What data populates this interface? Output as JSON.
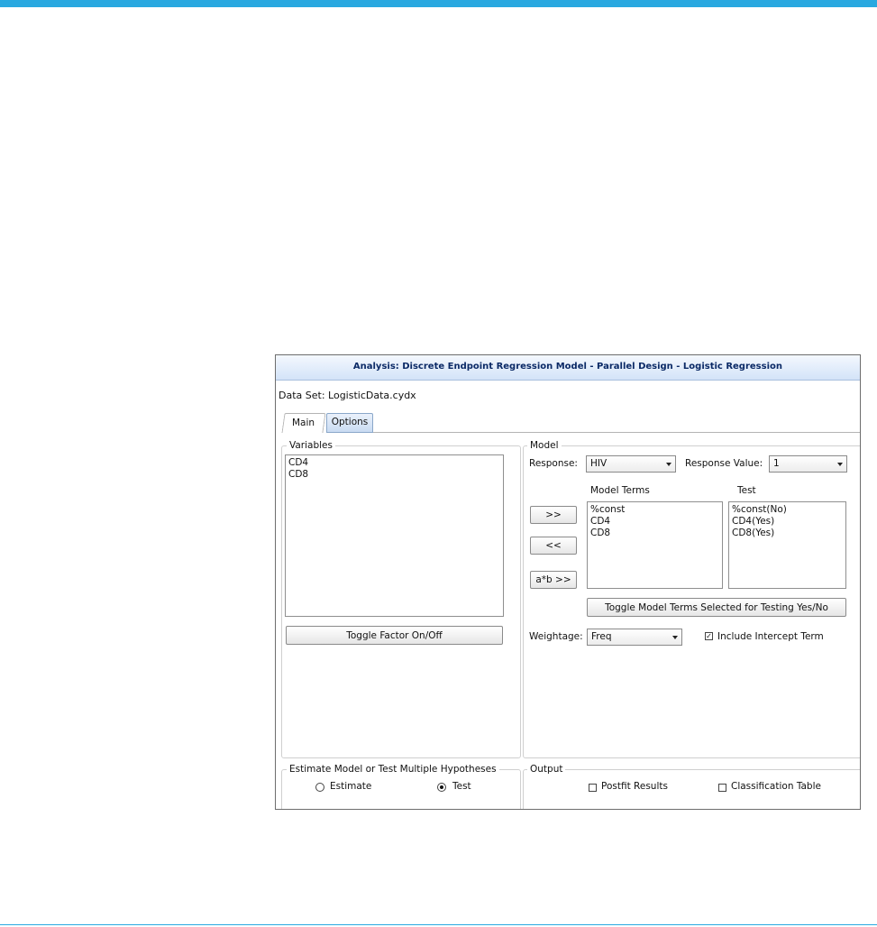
{
  "dialog": {
    "title": "Analysis: Discrete Endpoint Regression Model - Parallel Design - Logistic Regression",
    "dataset_label": "Data Set: LogisticData.cydx",
    "tabs": [
      {
        "label": "Main",
        "selected": true
      },
      {
        "label": "Options",
        "selected": false
      }
    ]
  },
  "variables": {
    "legend": "Variables",
    "items": [
      "CD4",
      "CD8"
    ],
    "toggle_button": "Toggle Factor On/Off"
  },
  "model": {
    "legend": "Model",
    "response_label": "Response:",
    "response_value": "HIV",
    "response_value_label": "Response Value:",
    "response_value_selected": "1",
    "model_terms_header": "Model Terms",
    "test_header": "Test",
    "model_terms": [
      "%const",
      "CD4",
      "CD8"
    ],
    "test_terms": [
      "%const(No)",
      "CD4(Yes)",
      "CD8(Yes)"
    ],
    "add_button": ">>",
    "remove_button": "<<",
    "interaction_button": "a*b >>",
    "toggle_test_button": "Toggle Model Terms Selected for Testing Yes/No",
    "weightage_label": "Weightage:",
    "weightage_value": "Freq",
    "include_intercept_label": "Include Intercept Term",
    "include_intercept_checked": true
  },
  "estimate": {
    "legend": "Estimate Model or Test Multiple Hypotheses",
    "options": [
      {
        "label": "Estimate",
        "selected": false
      },
      {
        "label": "Test",
        "selected": true
      }
    ]
  },
  "output": {
    "legend": "Output",
    "postfit_label": "Postfit Results",
    "postfit_checked": false,
    "classification_label": "Classification Table",
    "classification_checked": false
  }
}
